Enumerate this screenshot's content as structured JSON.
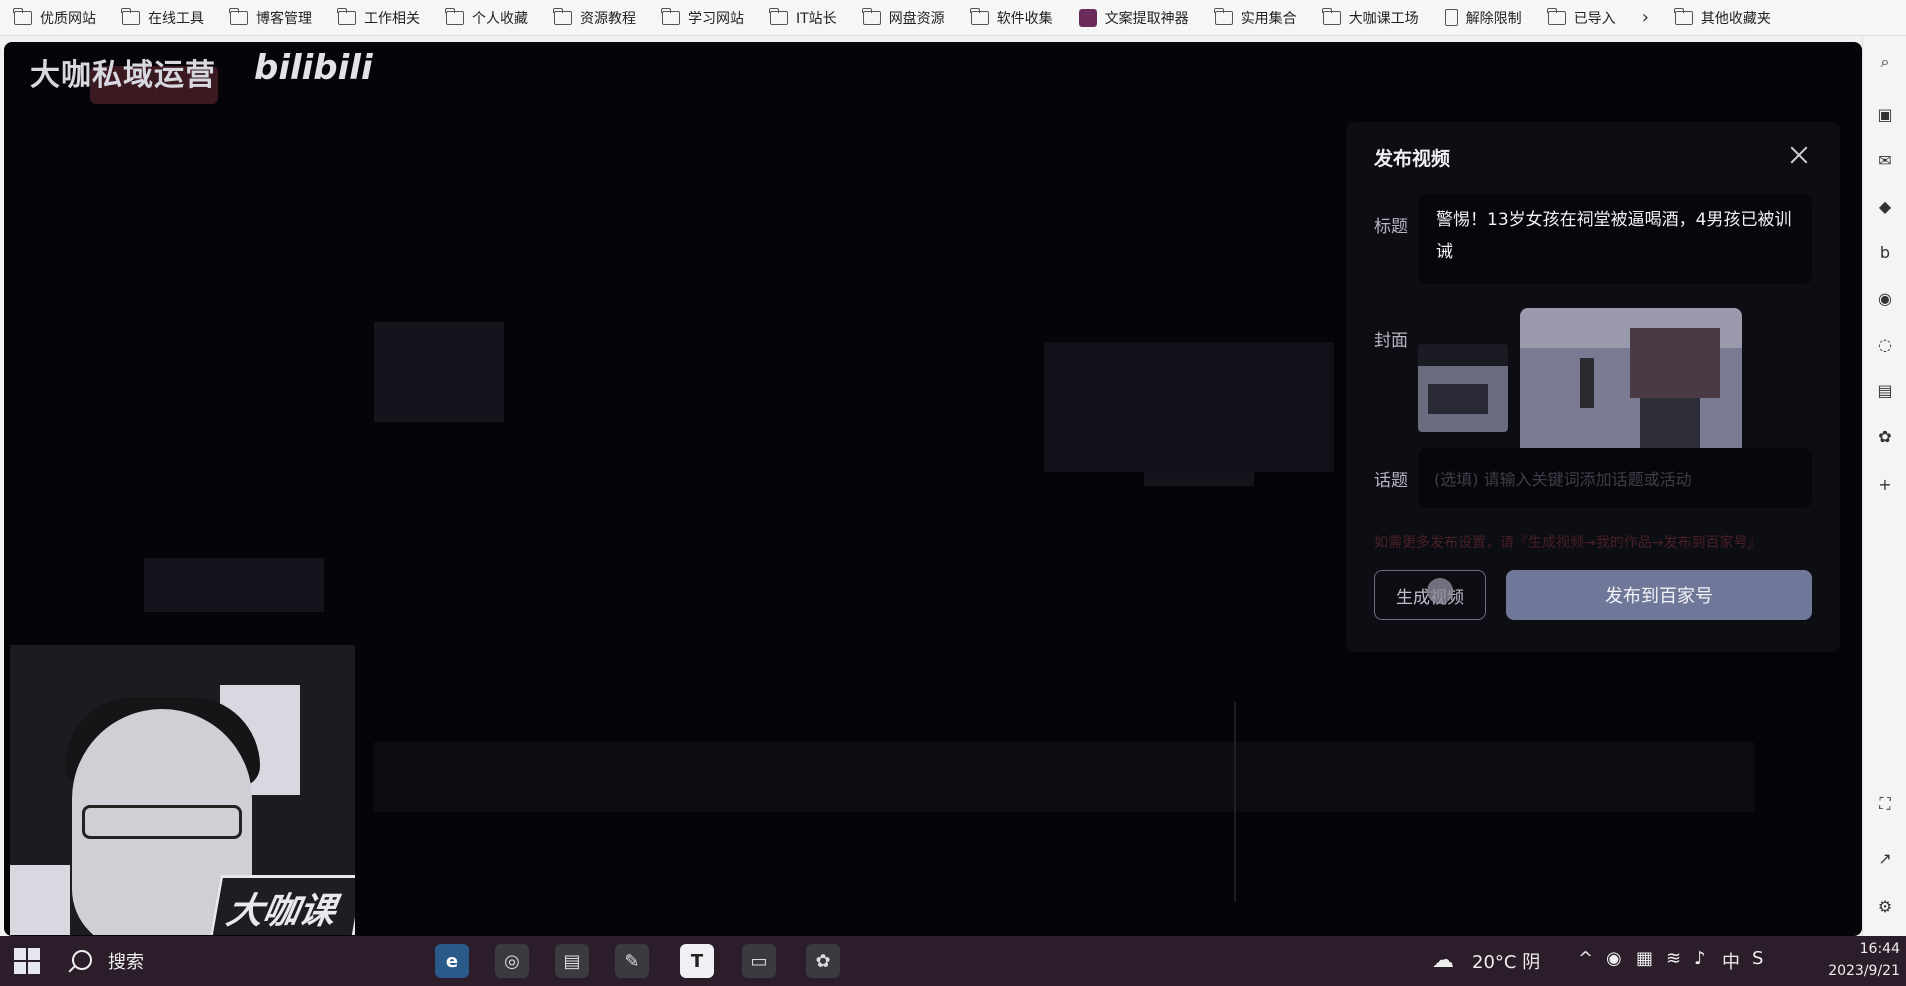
{
  "bookmarks": {
    "items": [
      "优质网站",
      "在线工具",
      "博客管理",
      "工作相关",
      "个人收藏",
      "资源教程",
      "学习网站",
      "IT站长",
      "网盘资源",
      "软件收集",
      "文案提取神器",
      "实用集合",
      "大咖课工场",
      "解除限制",
      "已导入"
    ],
    "more_label": "其他收藏夹"
  },
  "overlay": {
    "brand": "大咖私域运营",
    "platform_logo": "bilibili"
  },
  "publish_dialog": {
    "title": "发布视频",
    "title_label": "标题",
    "title_value": "警惕！13岁女孩在祠堂被逼喝酒，4男孩已被训诫",
    "cover_label": "封面",
    "topic_label": "话题",
    "topic_placeholder": "(选填) 请输入关键词添加话题或活动",
    "hint": "如需更多发布设置，请『生成视频→我的作品→发布到百家号』",
    "generate_button": "生成视频",
    "publish_button": "发布到百家号"
  },
  "webcam": {
    "watermark": "大咖课堂"
  },
  "taskbar": {
    "search_label": "搜索",
    "weather": "20°C 阴",
    "ime": "中",
    "time": "16:44",
    "date": "2023/9/21"
  }
}
